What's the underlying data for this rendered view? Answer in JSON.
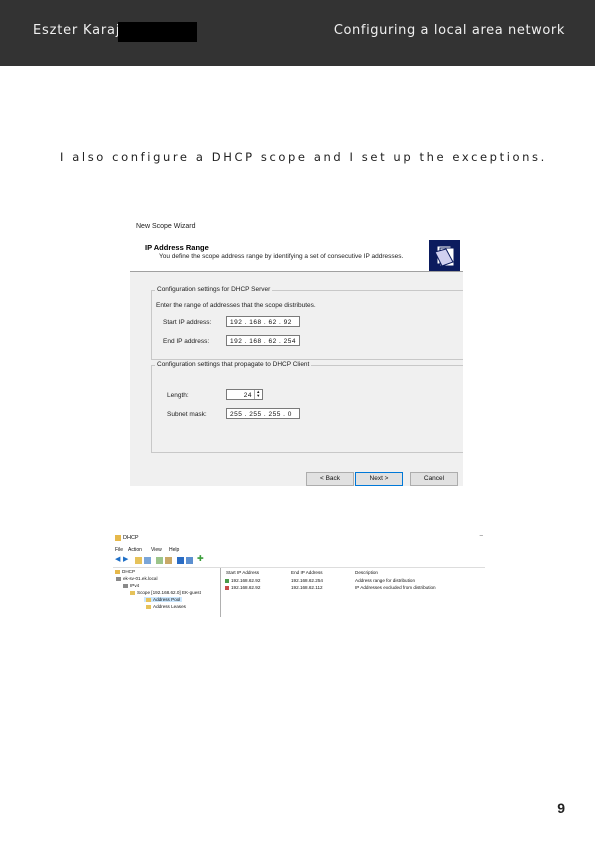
{
  "header": {
    "author": "Eszter Karajz",
    "title": "Configuring a local area network"
  },
  "body": {
    "text": "I also configure a DHCP scope and I set up the exceptions."
  },
  "wizard": {
    "window_caption": "New Scope Wizard",
    "heading": "IP Address Range",
    "subheading": "You define the scope address range by identifying a set of consecutive IP addresses.",
    "group1_title": "Configuration settings for DHCP Server",
    "group1_desc": "Enter the range of addresses that the scope distributes.",
    "start_label": "Start IP address:",
    "start_value": "192 . 168 . 62 . 92",
    "end_label": "End IP address:",
    "end_value": "192 . 168 . 62 . 254",
    "group2_title": "Configuration settings that propagate to DHCP Client",
    "length_label": "Length:",
    "length_value": "24",
    "mask_label": "Subnet mask:",
    "mask_value": "255 . 255 . 255 . 0",
    "back_label": "< Back",
    "next_label": "Next >",
    "cancel_label": "Cancel"
  },
  "dhcp": {
    "window_title": "DHCP",
    "minimize": "–",
    "menu": [
      "File",
      "Action",
      "View",
      "Help"
    ],
    "tree": {
      "root": "DHCP",
      "server": "ek-sv-01.ek.local",
      "ipv4": "IPv4",
      "scope": "Scope [192.168.62.0] EK-guest",
      "pool": "Address Pool",
      "leases": "Address Leases"
    },
    "columns": [
      "Start IP Address",
      "End IP Address",
      "Description"
    ],
    "rows": [
      {
        "start": "192.168.62.92",
        "end": "192.168.62.254",
        "description": "Address range for distribution"
      },
      {
        "start": "192.168.62.92",
        "end": "192.168.62.112",
        "description": "IP Addresses excluded from distribution"
      }
    ]
  },
  "page": {
    "number": "9"
  }
}
